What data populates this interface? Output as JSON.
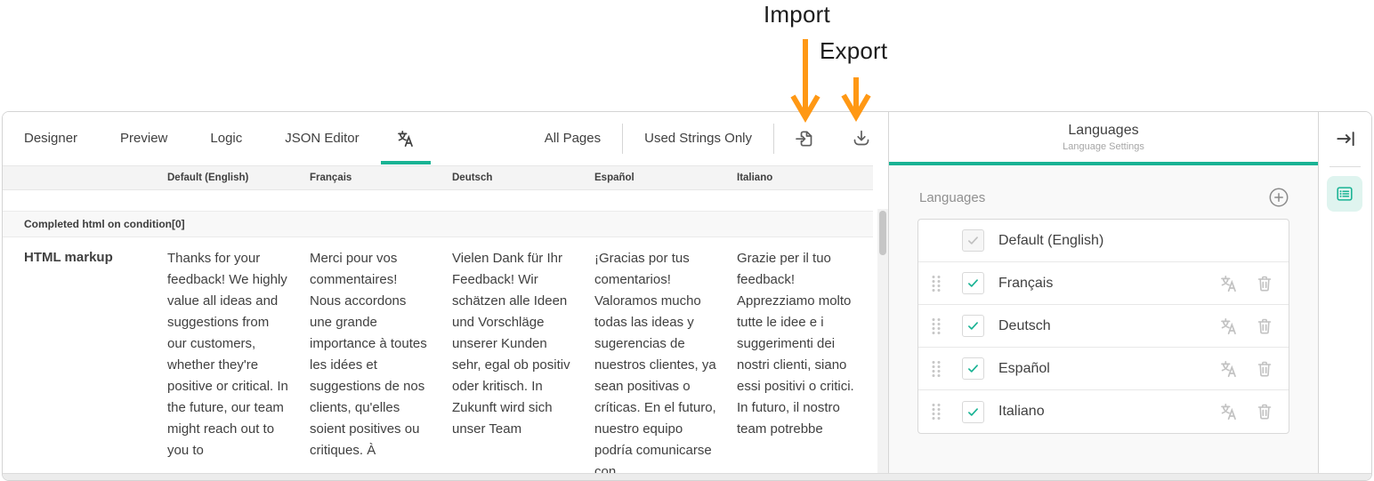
{
  "annotations": {
    "import": "Import",
    "export": "Export"
  },
  "tabs": {
    "designer": "Designer",
    "preview": "Preview",
    "logic": "Logic",
    "json_editor": "JSON Editor"
  },
  "toolbar": {
    "page_filter": "All Pages",
    "strings_filter": "Used Strings Only"
  },
  "table": {
    "columns": [
      "Default (English)",
      "Français",
      "Deutsch",
      "Español",
      "Italiano"
    ],
    "section_title": "Completed html on condition[0]",
    "row_label": "HTML markup",
    "translations": [
      "Thanks for your feedback! We highly value all ideas and suggestions from our customers, whether they're positive or critical. In the future, our team might reach out to you to",
      "Merci pour vos commentaires! Nous accordons une grande importance à toutes les idées et suggestions de nos clients, qu'elles soient positives ou critiques. À",
      "Vielen Dank für Ihr Feedback! Wir schätzen alle Ideen und Vorschläge unserer Kunden sehr, egal ob positiv oder kritisch. In Zukunft wird sich unser Team",
      "¡Gracias por tus comentarios! Valoramos mucho todas las ideas y sugerencias de nuestros clientes, ya sean positivas o críticas. En el futuro, nuestro equipo podría comunicarse con",
      "Grazie per il tuo feedback! Apprezziamo molto tutte le idee e i suggerimenti dei nostri clienti, siano essi positivi o critici. In futuro, il nostro team potrebbe"
    ]
  },
  "panel": {
    "title": "Languages",
    "subtitle": "Language Settings",
    "section_label": "Languages",
    "languages": [
      {
        "label": "Default (English)"
      },
      {
        "label": "Français"
      },
      {
        "label": "Deutsch"
      },
      {
        "label": "Español"
      },
      {
        "label": "Italiano"
      }
    ]
  },
  "colors": {
    "accent": "#19b394",
    "arrow": "#ff9814"
  }
}
